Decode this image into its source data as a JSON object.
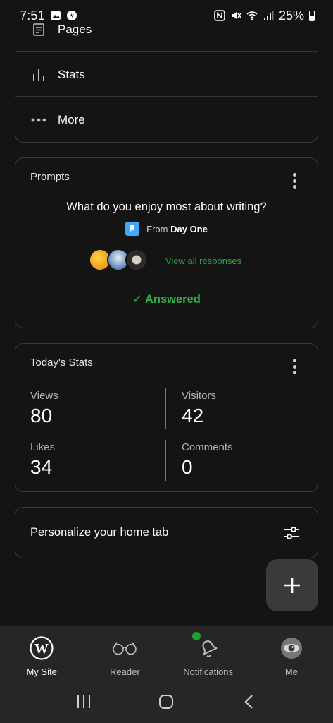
{
  "status_bar": {
    "time": "7:51",
    "battery": "25%"
  },
  "menu": {
    "items": [
      {
        "label": "Pages",
        "icon": "pages-icon"
      },
      {
        "label": "Stats",
        "icon": "stats-icon"
      },
      {
        "label": "More",
        "icon": "more-dots-icon"
      }
    ]
  },
  "prompts": {
    "title": "Prompts",
    "question": "What do you enjoy most about writing?",
    "from_prefix": "From",
    "from_source": "Day One",
    "view_all": "View all responses",
    "answered": "✓ Answered"
  },
  "stats": {
    "title": "Today's Stats",
    "items": [
      {
        "label": "Views",
        "value": "80"
      },
      {
        "label": "Visitors",
        "value": "42"
      },
      {
        "label": "Likes",
        "value": "34"
      },
      {
        "label": "Comments",
        "value": "0"
      }
    ]
  },
  "personalize": {
    "label": "Personalize your home tab"
  },
  "tabs": [
    {
      "label": "My Site",
      "icon": "wordpress-icon",
      "active": true
    },
    {
      "label": "Reader",
      "icon": "glasses-icon",
      "active": false
    },
    {
      "label": "Notifications",
      "icon": "bell-icon",
      "active": false
    },
    {
      "label": "Me",
      "icon": "avatar-icon",
      "active": false
    }
  ],
  "colors": {
    "accent_green": "#2fb344",
    "background": "#141414",
    "card_border": "#3a3a3a"
  }
}
